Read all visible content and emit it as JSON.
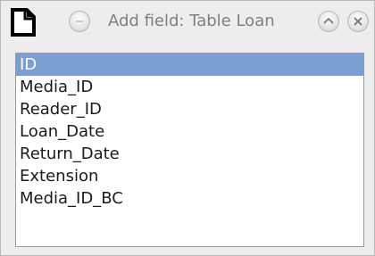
{
  "window": {
    "title": "Add field: Table Loan",
    "icons": [
      "document-icon",
      "minimize-icon",
      "maximize-icon",
      "close-icon"
    ]
  },
  "fields": {
    "items": [
      {
        "label": "ID",
        "selected": true
      },
      {
        "label": "Media_ID",
        "selected": false
      },
      {
        "label": "Reader_ID",
        "selected": false
      },
      {
        "label": "Loan_Date",
        "selected": false
      },
      {
        "label": "Return_Date",
        "selected": false
      },
      {
        "label": "Extension",
        "selected": false
      },
      {
        "label": "Media_ID_BC",
        "selected": false
      }
    ]
  },
  "colors": {
    "selection": "#7b9fd1",
    "window_bg": "#ededed",
    "list_bg": "#ffffff"
  }
}
